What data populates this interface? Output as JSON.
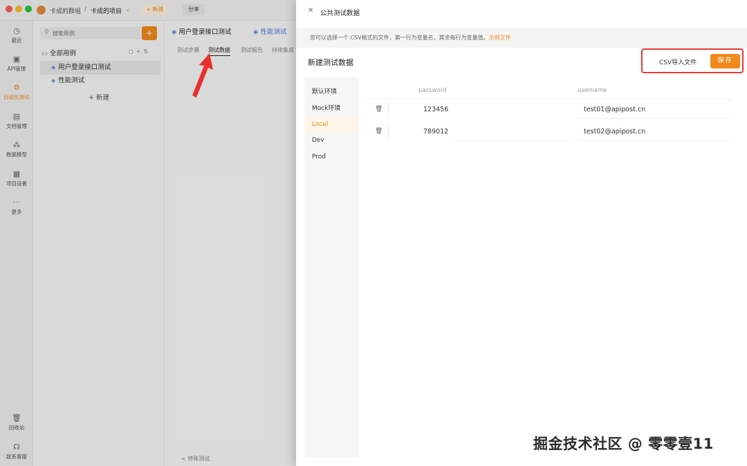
{
  "titlebar": {
    "team_name": "卡成的群组",
    "separator": "/",
    "project_name": "卡成的项目",
    "new_label": "+ 新建",
    "share_label": "分享"
  },
  "nav": [
    {
      "icon": "clock-icon",
      "label": "最近"
    },
    {
      "icon": "api-icon",
      "label": "API管理"
    },
    {
      "icon": "automation-icon",
      "label": "自动化测试",
      "active": true
    },
    {
      "icon": "document-icon",
      "label": "文档管理"
    },
    {
      "icon": "data-model-icon",
      "label": "数据模型"
    },
    {
      "icon": "settings-icon",
      "label": "项目设置"
    },
    {
      "icon": "more-icon",
      "label": "更多"
    },
    {
      "icon": "trash-icon",
      "label": "回收站"
    },
    {
      "icon": "headset-icon",
      "label": "联系客服"
    }
  ],
  "tree": {
    "search_placeholder": "搜索用例",
    "root_label": "全部用例",
    "items": [
      "用户登录接口测试",
      "性能测试"
    ],
    "new_label": "+ 新建"
  },
  "main": {
    "tabs": [
      "用户登录接口测试",
      "性能测试"
    ],
    "sub_tabs": [
      "测试步骤",
      "测试数据",
      "测试报告",
      "持续集成"
    ],
    "active_sub_tab": "测试数据",
    "feature_hint": "< 特殊测试"
  },
  "drawer": {
    "title": "公共测试数据",
    "hint_text": "您可以选择一个.CSV格式的文件，第一行为变量名，其余每行为变量值。",
    "hint_link": "示例文件",
    "dataset_title": "新建测试数据",
    "csv_import_label": "CSV导入文件",
    "save_label": "保存",
    "environments": [
      "默认环境",
      "Mock环境",
      "Local",
      "Dev",
      "Prod"
    ],
    "active_environment": "Local",
    "columns": [
      "password",
      "username"
    ],
    "rows": [
      {
        "password": "123456",
        "username": "test01@apipost.cn"
      },
      {
        "password": "789012",
        "username": "test02@apipost.cn"
      }
    ]
  },
  "watermark": "掘金技术社区 @ 零零壹11",
  "colors": {
    "accent": "#f08a1c",
    "highlight_border": "#e53935",
    "arrow": "#e8302e"
  }
}
